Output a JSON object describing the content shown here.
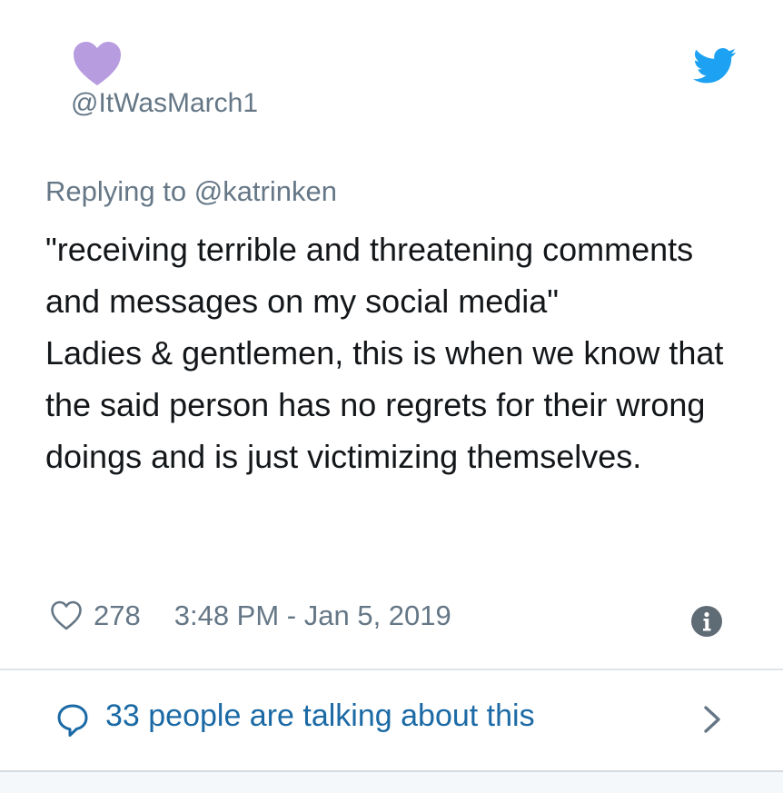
{
  "tweet": {
    "handle": "@ItWasMarch1",
    "reply_prefix": "Replying to ",
    "reply_to": "@katrinken",
    "text_paragraphs": [
      "\"receiving terrible and threatening comments and messages on my social media\"",
      "Ladies & gentlemen, this is when we know that the said person has no regrets for their wrong doings and is just victimizing themselves."
    ],
    "like_count": "278",
    "timestamp": "3:48 PM - Jan 5, 2019"
  },
  "footer": {
    "talking_text": "33 people are talking about this"
  },
  "icons": {
    "avatar": "purple-heart-icon",
    "brand": "twitter-bird-icon",
    "like": "heart-outline-icon",
    "info": "info-icon",
    "reply": "speech-bubble-icon",
    "chevron": "chevron-right-icon"
  },
  "colors": {
    "avatar_purple": "#b89ce0",
    "twitter_blue": "#1da1f2",
    "link_blue": "#1b6aa5",
    "meta_gray": "#657786",
    "text_dark": "#14171a"
  }
}
